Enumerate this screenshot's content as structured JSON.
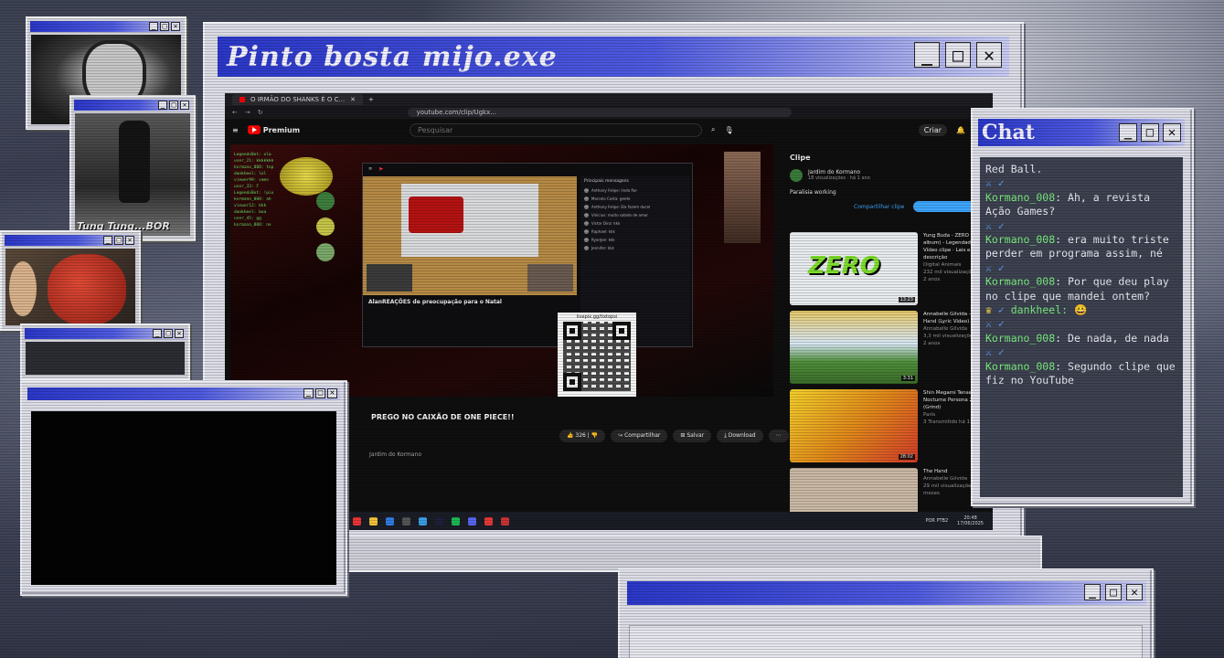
{
  "main_window": {
    "title": "Pinto bosta mijo.exe",
    "controls": {
      "minimize": "_",
      "maximize": "□",
      "close": "✕"
    }
  },
  "browser": {
    "tab_title": "O IRMÃO DO SHANKS É O C...",
    "url": "youtube.com/clip/Ugkx...",
    "youtube": {
      "logo": "Premium",
      "search_placeholder": "Pesquisar",
      "create_label": "Criar"
    },
    "video": {
      "title": "PREGO NO CAIXÃO DE ONE PIECE!!",
      "channel_text": "Jardim do Kormano",
      "like_count": "326",
      "share_label": "Compartilhar",
      "save_label": "Salvar",
      "download_label": "Download",
      "qr_caption": "livepix.gg/tixtopsi",
      "chat_lines": [
        "LegendsBot: ola",
        "user_21: kkkkkkk",
        "kormano_008: top",
        "dankheel: lol",
        "viewer99: vamo",
        "user_33: F",
        "LegendsBot: !pix",
        "kormano_008: ah",
        "viewer12: kkk",
        "dankheel: boa",
        "user_45: gg",
        "kormano_008: ne"
      ]
    },
    "inner_stream": {
      "title": "AlanREAÇÕES de preocupação para o Natal",
      "chat_header": "Principais mensagens",
      "chat_rows": [
        "Anthony Felipe: linda flor",
        "Marcelo Costa: gente",
        "Anthony Felipe: Ela fazem ducel",
        "Vinicius: muito sabido de amor",
        "Victor Dinz: kkk",
        "Raphael: kkk",
        "RyanJoe: kkk",
        "Jennifer: kkk"
      ]
    },
    "sidebar": {
      "heading": "Clipe",
      "channel": "Jardim do Kormano",
      "channel_meta": "18 visualizações · há 1 ano",
      "clip_label": "Paralisia working",
      "share_clip": "Compartilhar clipe",
      "recommendations": [
        {
          "title": "Yung Buda - ZERO (full album) - Legendado · Vídeo clipe · Lais e descrição",
          "channel": "Digital Animals",
          "meta": "232 mil visualizações · há 2 anos",
          "duration": "13:23",
          "thumb_text": "ZERO"
        },
        {
          "title": "Annabelle Gilvida - The Hand (Lyric Video)",
          "channel": "Annabelle Gilvida",
          "meta": "3,3 mil visualizações · há 2 anos",
          "duration": "3:31",
          "thumb_text": ""
        },
        {
          "title": "Shin Megami Tensei III Nocturne Persona 28 (Grind)",
          "channel": "Paris",
          "meta": "3 Transmitido há 11 dias",
          "duration": "28:02",
          "thumb_text": ""
        },
        {
          "title": "The Hand",
          "channel": "Annabelle Gilvida",
          "meta": "29 mil visualizações · há 6 meses",
          "duration": "",
          "thumb_text": ""
        }
      ]
    },
    "taskbar": {
      "lang": "POR PTB2",
      "time": "20:48",
      "date": "17/06/2025"
    }
  },
  "webcams": [
    {
      "label": ""
    },
    {
      "label": "Tung Tung...BOR"
    },
    {
      "label": ""
    },
    {
      "label": ""
    }
  ],
  "chat_window": {
    "title": "Chat",
    "messages": [
      {
        "user": "",
        "text": "Red Ball."
      },
      {
        "user": "Kormano_008",
        "text": ": Ah, a revista Ação Games?"
      },
      {
        "user": "Kormano_008",
        "text": ": era muito triste perder em programa assim, né"
      },
      {
        "user": "Kormano_008",
        "text": ": Por que deu play no clipe que mandei ontem?"
      },
      {
        "user": "dankheel",
        "text": ": 😀"
      },
      {
        "user": "Kormano_008",
        "text": ": De nada, de nada"
      },
      {
        "user": "Kormano_008",
        "text": ": Segundo clipe que fiz no YouTube"
      }
    ]
  },
  "colors": {
    "title_blue": "#2b38c9",
    "chat_username": "#7bf07f",
    "window_gray": "#dcdde6"
  }
}
